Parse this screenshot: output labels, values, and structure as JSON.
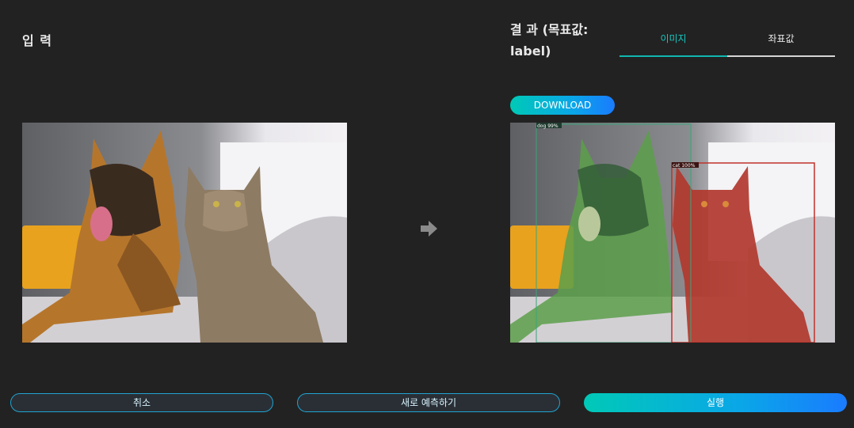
{
  "input": {
    "title": "입 력"
  },
  "result": {
    "title": "결 과 (목표값: label)",
    "tabs": [
      {
        "label": "이미지",
        "active": true
      },
      {
        "label": "좌표값",
        "active": false
      }
    ],
    "download_label": "DOWNLOAD",
    "detections": [
      {
        "label": "dog 99%",
        "color": "#3aa57a"
      },
      {
        "label": "cat 100%",
        "color": "#c0322b"
      }
    ]
  },
  "buttons": {
    "cancel": "취소",
    "repredict": "새로 예측하기",
    "run": "실행"
  },
  "colors": {
    "background": "#222222",
    "accent": "#0fb8b0",
    "gradient_start": "#00c9b7",
    "gradient_end": "#1a7bff"
  },
  "icons": {
    "arrow": "arrow-right-icon"
  }
}
